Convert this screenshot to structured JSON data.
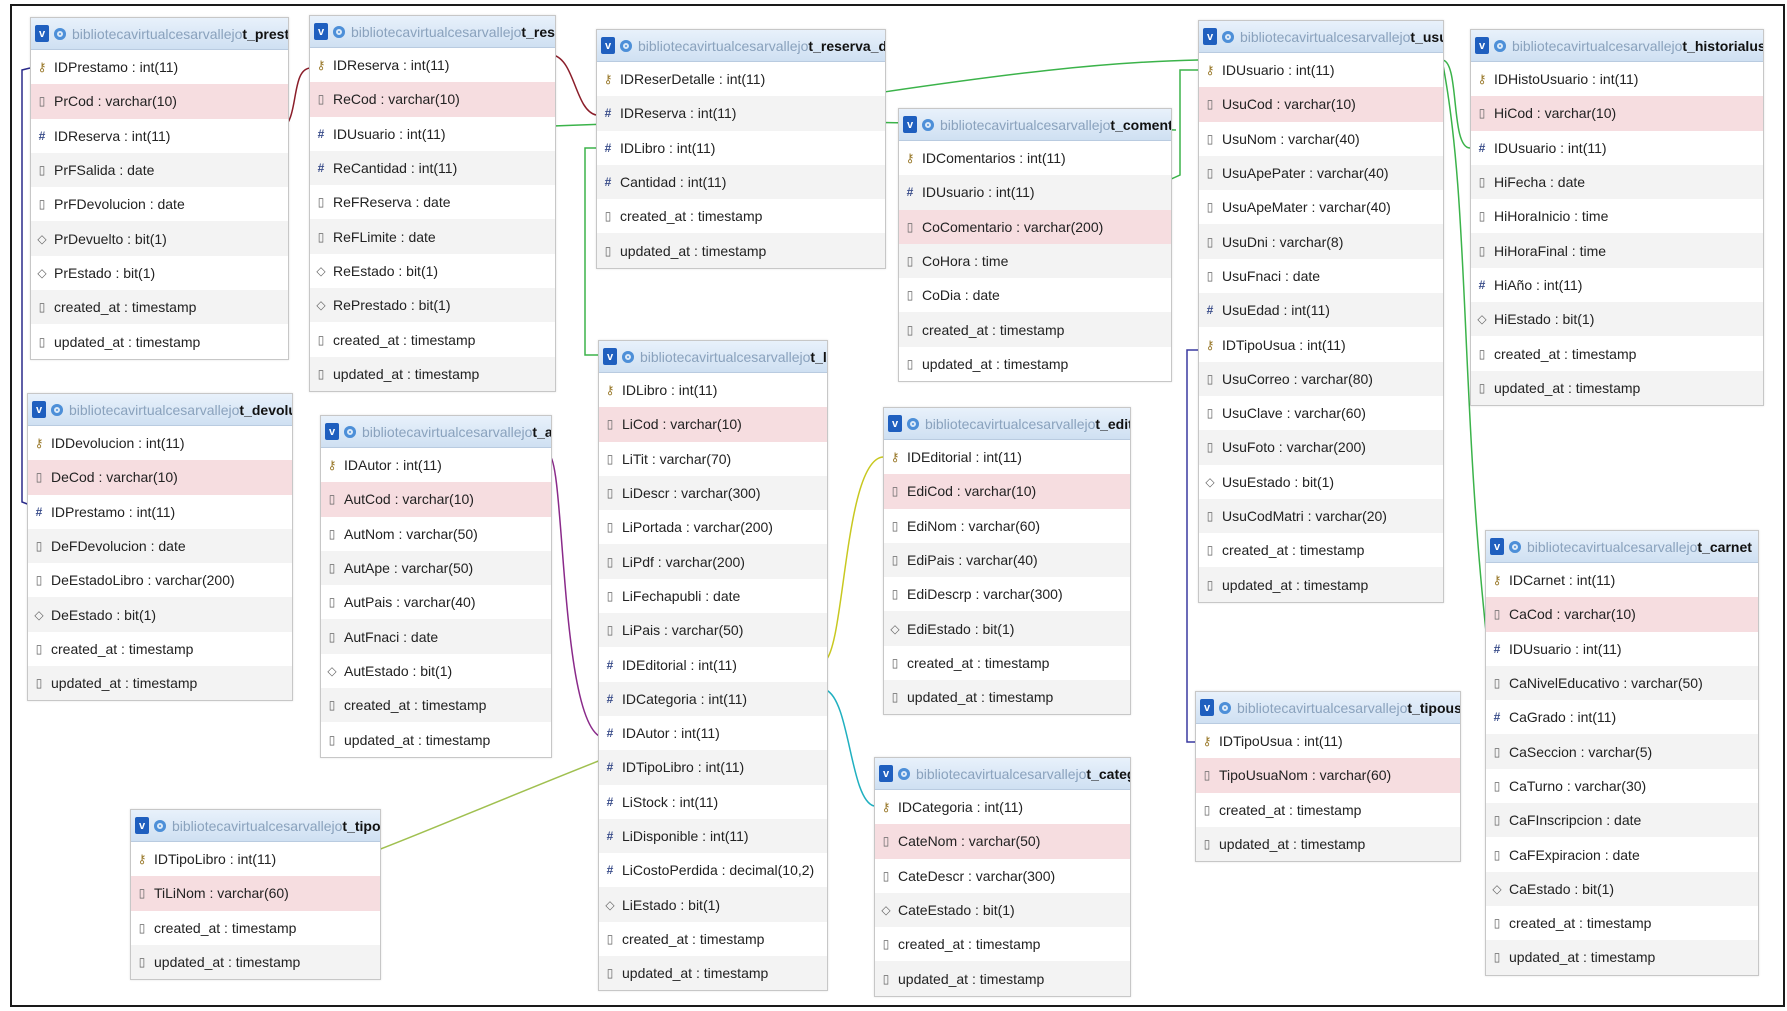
{
  "database": "bibliotecavirtualcesarvallejo",
  "icons": {
    "collapse": "v",
    "table": "table-icon"
  },
  "colors": {
    "header_top": "#e8f1fb",
    "header_bottom": "#cfe0f2",
    "unique_row": "#f6dde0",
    "alt_row": "#f3f3f3"
  },
  "tables": [
    {
      "name": "t_prestamo",
      "rows": [
        {
          "text": "IDPrestamo : int(11)",
          "kind": "pk"
        },
        {
          "text": "PrCod : varchar(10)",
          "kind": "uniq"
        },
        {
          "text": "IDReserva : int(11)",
          "kind": "fk"
        },
        {
          "text": "PrFSalida : date",
          "kind": "col"
        },
        {
          "text": "PrFDevolucion : date",
          "kind": "col"
        },
        {
          "text": "PrDevuelto : bit(1)",
          "kind": "bit"
        },
        {
          "text": "PrEstado : bit(1)",
          "kind": "bit"
        },
        {
          "text": "created_at : timestamp",
          "kind": "col"
        },
        {
          "text": "updated_at : timestamp",
          "kind": "col"
        }
      ]
    },
    {
      "name": "t_reserva",
      "rows": [
        {
          "text": "IDReserva : int(11)",
          "kind": "pk"
        },
        {
          "text": "ReCod : varchar(10)",
          "kind": "uniq"
        },
        {
          "text": "IDUsuario : int(11)",
          "kind": "fk"
        },
        {
          "text": "ReCantidad : int(11)",
          "kind": "fk"
        },
        {
          "text": "ReFReserva : date",
          "kind": "col"
        },
        {
          "text": "ReFLimite : date",
          "kind": "col"
        },
        {
          "text": "ReEstado : bit(1)",
          "kind": "bit"
        },
        {
          "text": "RePrestado : bit(1)",
          "kind": "bit"
        },
        {
          "text": "created_at : timestamp",
          "kind": "col"
        },
        {
          "text": "updated_at : timestamp",
          "kind": "col"
        }
      ]
    },
    {
      "name": "t_reserva_detalle",
      "rows": [
        {
          "text": "IDReserDetalle : int(11)",
          "kind": "pk"
        },
        {
          "text": "IDReserva : int(11)",
          "kind": "fk"
        },
        {
          "text": "IDLibro : int(11)",
          "kind": "fk"
        },
        {
          "text": "Cantidad : int(11)",
          "kind": "fk"
        },
        {
          "text": "created_at : timestamp",
          "kind": "col"
        },
        {
          "text": "updated_at : timestamp",
          "kind": "col"
        }
      ]
    },
    {
      "name": "t_comentarios",
      "rows": [
        {
          "text": "IDComentarios : int(11)",
          "kind": "pk"
        },
        {
          "text": "IDUsuario : int(11)",
          "kind": "fk"
        },
        {
          "text": "CoComentario : varchar(200)",
          "kind": "uniq"
        },
        {
          "text": "CoHora : time",
          "kind": "col"
        },
        {
          "text": "CoDia : date",
          "kind": "col"
        },
        {
          "text": "created_at : timestamp",
          "kind": "col"
        },
        {
          "text": "updated_at : timestamp",
          "kind": "col"
        }
      ]
    },
    {
      "name": "t_usuario",
      "rows": [
        {
          "text": "IDUsuario : int(11)",
          "kind": "pk"
        },
        {
          "text": "UsuCod : varchar(10)",
          "kind": "uniq"
        },
        {
          "text": "UsuNom : varchar(40)",
          "kind": "col"
        },
        {
          "text": "UsuApePater : varchar(40)",
          "kind": "col"
        },
        {
          "text": "UsuApeMater : varchar(40)",
          "kind": "col"
        },
        {
          "text": "UsuDni : varchar(8)",
          "kind": "col"
        },
        {
          "text": "UsuFnaci : date",
          "kind": "col"
        },
        {
          "text": "UsuEdad : int(11)",
          "kind": "fk"
        },
        {
          "text": "IDTipoUsua : int(11)",
          "kind": "pk"
        },
        {
          "text": "UsuCorreo : varchar(80)",
          "kind": "col"
        },
        {
          "text": "UsuClave : varchar(60)",
          "kind": "col"
        },
        {
          "text": "UsuFoto : varchar(200)",
          "kind": "col"
        },
        {
          "text": "UsuEstado : bit(1)",
          "kind": "bit"
        },
        {
          "text": "UsuCodMatri : varchar(20)",
          "kind": "col"
        },
        {
          "text": "created_at : timestamp",
          "kind": "col"
        },
        {
          "text": "updated_at : timestamp",
          "kind": "col"
        }
      ]
    },
    {
      "name": "t_historialusuario",
      "rows": [
        {
          "text": "IDHistoUsuario : int(11)",
          "kind": "pk"
        },
        {
          "text": "HiCod : varchar(10)",
          "kind": "uniq"
        },
        {
          "text": "IDUsuario : int(11)",
          "kind": "fk"
        },
        {
          "text": "HiFecha : date",
          "kind": "col"
        },
        {
          "text": "HiHoraInicio : time",
          "kind": "col"
        },
        {
          "text": "HiHoraFinal : time",
          "kind": "col"
        },
        {
          "text": "HiAño : int(11)",
          "kind": "fk"
        },
        {
          "text": "HiEstado : bit(1)",
          "kind": "bit"
        },
        {
          "text": "created_at : timestamp",
          "kind": "col"
        },
        {
          "text": "updated_at : timestamp",
          "kind": "col"
        }
      ]
    },
    {
      "name": "t_devolucion",
      "rows": [
        {
          "text": "IDDevolucion : int(11)",
          "kind": "pk"
        },
        {
          "text": "DeCod : varchar(10)",
          "kind": "uniq"
        },
        {
          "text": "IDPrestamo : int(11)",
          "kind": "fk"
        },
        {
          "text": "DeFDevolucion : date",
          "kind": "col"
        },
        {
          "text": "DeEstadoLibro : varchar(200)",
          "kind": "col"
        },
        {
          "text": "DeEstado : bit(1)",
          "kind": "bit"
        },
        {
          "text": "created_at : timestamp",
          "kind": "col"
        },
        {
          "text": "updated_at : timestamp",
          "kind": "col"
        }
      ]
    },
    {
      "name": "t_autor",
      "rows": [
        {
          "text": "IDAutor : int(11)",
          "kind": "pk"
        },
        {
          "text": "AutCod : varchar(10)",
          "kind": "uniq"
        },
        {
          "text": "AutNom : varchar(50)",
          "kind": "col"
        },
        {
          "text": "AutApe : varchar(50)",
          "kind": "col"
        },
        {
          "text": "AutPais : varchar(40)",
          "kind": "col"
        },
        {
          "text": "AutFnaci : date",
          "kind": "col"
        },
        {
          "text": "AutEstado : bit(1)",
          "kind": "bit"
        },
        {
          "text": "created_at : timestamp",
          "kind": "col"
        },
        {
          "text": "updated_at : timestamp",
          "kind": "col"
        }
      ]
    },
    {
      "name": "t_libro",
      "rows": [
        {
          "text": "IDLibro : int(11)",
          "kind": "pk"
        },
        {
          "text": "LiCod : varchar(10)",
          "kind": "uniq"
        },
        {
          "text": "LiTit : varchar(70)",
          "kind": "col"
        },
        {
          "text": "LiDescr : varchar(300)",
          "kind": "col"
        },
        {
          "text": "LiPortada : varchar(200)",
          "kind": "col"
        },
        {
          "text": "LiPdf : varchar(200)",
          "kind": "col"
        },
        {
          "text": "LiFechapubli : date",
          "kind": "col"
        },
        {
          "text": "LiPais : varchar(50)",
          "kind": "col"
        },
        {
          "text": "IDEditorial : int(11)",
          "kind": "fk"
        },
        {
          "text": "IDCategoria : int(11)",
          "kind": "fk"
        },
        {
          "text": "IDAutor : int(11)",
          "kind": "fk"
        },
        {
          "text": "IDTipoLibro : int(11)",
          "kind": "fk"
        },
        {
          "text": "LiStock : int(11)",
          "kind": "fk"
        },
        {
          "text": "LiDisponible : int(11)",
          "kind": "fk"
        },
        {
          "text": "LiCostoPerdida : decimal(10,2)",
          "kind": "fk"
        },
        {
          "text": "LiEstado : bit(1)",
          "kind": "bit"
        },
        {
          "text": "created_at : timestamp",
          "kind": "col"
        },
        {
          "text": "updated_at : timestamp",
          "kind": "col"
        }
      ]
    },
    {
      "name": "t_editorial",
      "rows": [
        {
          "text": "IDEditorial : int(11)",
          "kind": "pk"
        },
        {
          "text": "EdiCod : varchar(10)",
          "kind": "uniq"
        },
        {
          "text": "EdiNom : varchar(60)",
          "kind": "col"
        },
        {
          "text": "EdiPais : varchar(40)",
          "kind": "col"
        },
        {
          "text": "EdiDescrp : varchar(300)",
          "kind": "col"
        },
        {
          "text": "EdiEstado : bit(1)",
          "kind": "bit"
        },
        {
          "text": "created_at : timestamp",
          "kind": "col"
        },
        {
          "text": "updated_at : timestamp",
          "kind": "col"
        }
      ]
    },
    {
      "name": "t_carnet",
      "rows": [
        {
          "text": "IDCarnet : int(11)",
          "kind": "pk"
        },
        {
          "text": "CaCod : varchar(10)",
          "kind": "uniq"
        },
        {
          "text": "IDUsuario : int(11)",
          "kind": "fk"
        },
        {
          "text": "CaNivelEducativo : varchar(50)",
          "kind": "col"
        },
        {
          "text": "CaGrado : int(11)",
          "kind": "fk"
        },
        {
          "text": "CaSeccion : varchar(5)",
          "kind": "col"
        },
        {
          "text": "CaTurno : varchar(30)",
          "kind": "col"
        },
        {
          "text": "CaFInscripcion : date",
          "kind": "col"
        },
        {
          "text": "CaFExpiracion : date",
          "kind": "col"
        },
        {
          "text": "CaEstado : bit(1)",
          "kind": "bit"
        },
        {
          "text": "created_at : timestamp",
          "kind": "col"
        },
        {
          "text": "updated_at : timestamp",
          "kind": "col"
        }
      ]
    },
    {
      "name": "t_tipousuario",
      "rows": [
        {
          "text": "IDTipoUsua : int(11)",
          "kind": "pk"
        },
        {
          "text": "TipoUsuaNom : varchar(60)",
          "kind": "uniq"
        },
        {
          "text": "created_at : timestamp",
          "kind": "col"
        },
        {
          "text": "updated_at : timestamp",
          "kind": "col"
        }
      ]
    },
    {
      "name": "t_categoria",
      "rows": [
        {
          "text": "IDCategoria : int(11)",
          "kind": "pk"
        },
        {
          "text": "CateNom : varchar(50)",
          "kind": "uniq"
        },
        {
          "text": "CateDescr : varchar(300)",
          "kind": "col"
        },
        {
          "text": "CateEstado : bit(1)",
          "kind": "bit"
        },
        {
          "text": "created_at : timestamp",
          "kind": "col"
        },
        {
          "text": "updated_at : timestamp",
          "kind": "col"
        }
      ]
    },
    {
      "name": "t_tipolibro",
      "rows": [
        {
          "text": "IDTipoLibro : int(11)",
          "kind": "pk"
        },
        {
          "text": "TiLiNom : varchar(60)",
          "kind": "uniq"
        },
        {
          "text": "created_at : timestamp",
          "kind": "col"
        },
        {
          "text": "updated_at : timestamp",
          "kind": "col"
        }
      ]
    }
  ],
  "relations": [
    {
      "from": "t_prestamo",
      "to": "t_reserva",
      "color": "#8b1e2a"
    },
    {
      "from": "t_prestamo",
      "to": "t_devolucion",
      "color": "#2a2a8a"
    },
    {
      "from": "t_reserva",
      "to": "t_reserva_detalle",
      "color": "#8b1e2a"
    },
    {
      "from": "t_reserva",
      "to": "t_usuario",
      "color": "#3bb34a"
    },
    {
      "from": "t_reserva_detalle",
      "to": "t_usuario",
      "color": "#3bb34a"
    },
    {
      "from": "t_reserva_detalle",
      "to": "t_libro",
      "color": "#3bb34a"
    },
    {
      "from": "t_comentarios",
      "to": "t_usuario",
      "color": "#3bb34a"
    },
    {
      "from": "t_usuario",
      "to": "t_historialusuario",
      "color": "#3bb34a"
    },
    {
      "from": "t_usuario",
      "to": "t_carnet",
      "color": "#3bb34a"
    },
    {
      "from": "t_usuario",
      "to": "t_tipousuario",
      "color": "#3a3aa0"
    },
    {
      "from": "t_autor",
      "to": "t_libro",
      "color": "#8a2a8a"
    },
    {
      "from": "t_libro",
      "to": "t_editorial",
      "color": "#c8c820"
    },
    {
      "from": "t_libro",
      "to": "t_categoria",
      "color": "#20b0c0"
    },
    {
      "from": "t_libro",
      "to": "t_tipolibro",
      "color": "#a0c050"
    }
  ]
}
